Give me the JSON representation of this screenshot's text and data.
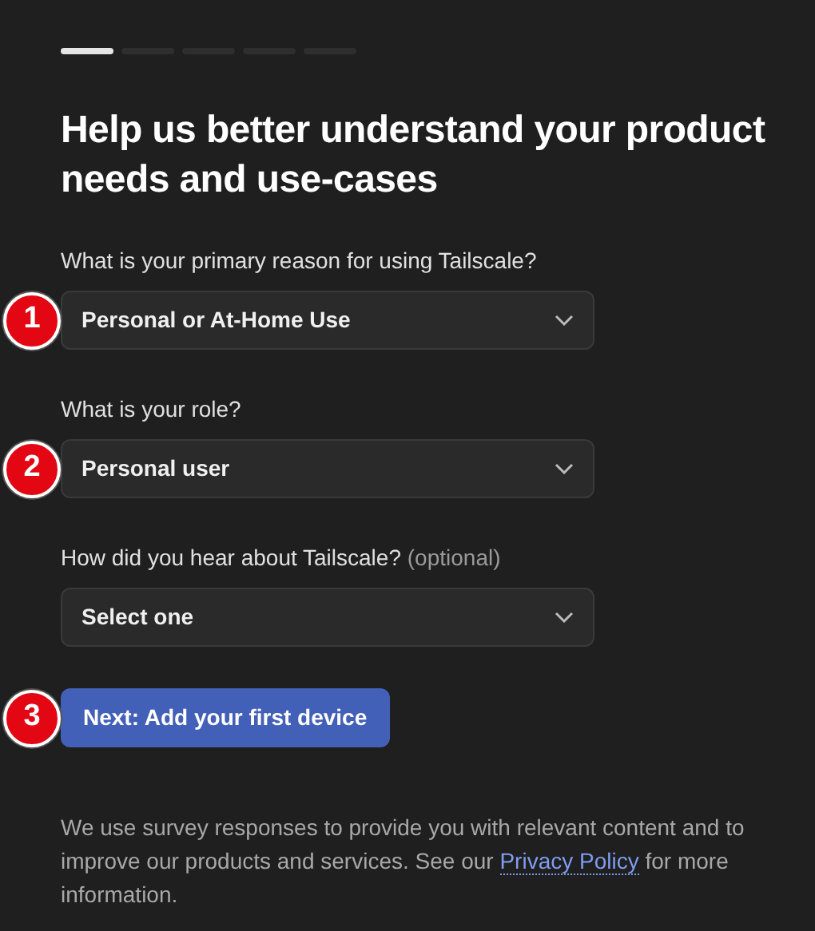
{
  "progress": [
    {
      "selected": true
    },
    {
      "selected": false
    },
    {
      "selected": false
    },
    {
      "selected": false
    },
    {
      "selected": false
    }
  ],
  "heading": "Help us better understand your product needs and use-cases",
  "fields": [
    {
      "label": "What is your primary reason for using Tailscale?",
      "value": "Personal or At-Home Use",
      "marker": "1"
    },
    {
      "label": "What is your role?",
      "value": "Personal user",
      "marker": "2"
    },
    {
      "label": "How did you hear about Tailscale?",
      "hint": "(optional)",
      "placeholder": "Select one"
    }
  ],
  "next_button": {
    "label": "Next: Add your first device",
    "marker": "3"
  },
  "notice": {
    "before": "We use survey responses to provide you with relevant content and to improve our products and services. See our",
    "link": "Privacy Policy",
    "after": "for more information."
  }
}
